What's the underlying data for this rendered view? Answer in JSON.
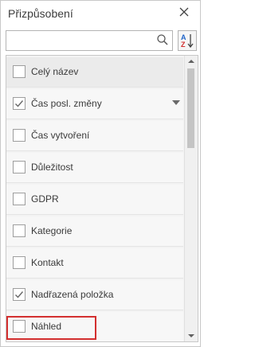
{
  "window": {
    "title": "Přizpůsobení"
  },
  "search": {
    "value": "",
    "placeholder": ""
  },
  "icons": {
    "close": "close-icon",
    "search": "search-icon",
    "sort": "sort-az-icon",
    "dropdown": "chevron-down-icon"
  },
  "items": [
    {
      "label": "Celý název",
      "checked": false
    },
    {
      "label": "Čas posl. změny",
      "checked": true
    },
    {
      "label": "Čas vytvoření",
      "checked": false
    },
    {
      "label": "Důležitost",
      "checked": false
    },
    {
      "label": "GDPR",
      "checked": false
    },
    {
      "label": "Kategorie",
      "checked": false
    },
    {
      "label": "Kontakt",
      "checked": false
    },
    {
      "label": "Nadřazená položka",
      "checked": true
    },
    {
      "label": "Náhled",
      "checked": false
    }
  ],
  "colors": {
    "highlight": "#d32f2f",
    "sort_blue": "#1e63c8",
    "sort_red": "#d32f2f"
  }
}
